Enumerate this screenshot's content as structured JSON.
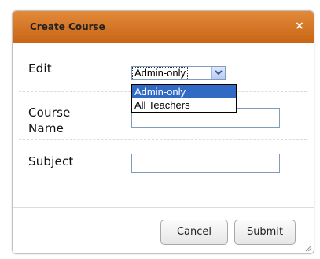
{
  "dialog": {
    "title": "Create Course",
    "close_glyph": "×"
  },
  "form": {
    "edit_label": "Edit",
    "edit_selected": "Admin-only",
    "edit_options": [
      "Admin-only",
      "All Teachers"
    ],
    "course_name_label_line1": "Course",
    "course_name_label_line2": "Name",
    "course_name_value": "",
    "subject_label": "Subject",
    "subject_value": ""
  },
  "buttons": {
    "cancel": "Cancel",
    "submit": "Submit"
  },
  "colors": {
    "titlebar": "#d9782a",
    "selection": "#316ac5"
  },
  "icons": {
    "close": "close-icon",
    "dropdown": "chevron-down-icon",
    "resize": "resize-grip-icon"
  }
}
